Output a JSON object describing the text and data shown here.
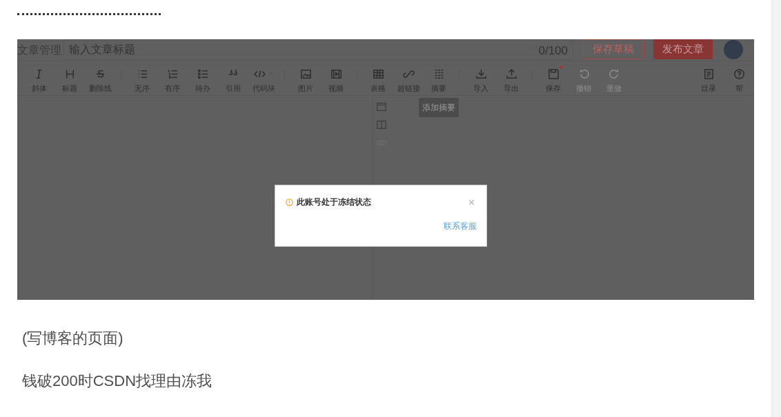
{
  "editor_screenshot": {
    "header": {
      "section": "文章管理",
      "title_field": {
        "placeholder": "输入文章标题"
      },
      "counter": "0/100",
      "buttons": [
        {
          "label": "保存草稿",
          "kind": "outline"
        },
        {
          "label": "发布文章",
          "kind": "primary"
        }
      ]
    },
    "toolbar": {
      "groups": [
        [
          {
            "label": "斜体",
            "disabled": false
          },
          {
            "label": "标题",
            "disabled": false
          },
          {
            "label": "删除线",
            "disabled": false
          }
        ],
        [
          {
            "label": "无序",
            "disabled": false
          },
          {
            "label": "有序",
            "disabled": false
          },
          {
            "label": "待办",
            "disabled": false
          },
          {
            "label": "引用",
            "disabled": false
          },
          {
            "label": "代码块",
            "disabled": false,
            "dropdown": true
          }
        ],
        [
          {
            "label": "图片",
            "disabled": false
          },
          {
            "label": "视频",
            "disabled": false
          }
        ],
        [
          {
            "label": "表格",
            "disabled": false
          },
          {
            "label": "超链接",
            "disabled": false
          },
          {
            "label": "摘要",
            "disabled": false,
            "tooltip": "添加摘要"
          }
        ],
        [
          {
            "label": "导入",
            "disabled": false
          },
          {
            "label": "导出",
            "disabled": false
          }
        ],
        [
          {
            "label": "保存",
            "disabled": false,
            "unsaved_dot": true
          },
          {
            "label": "撤销",
            "disabled": true
          },
          {
            "label": "重做",
            "disabled": true
          }
        ],
        [
          {
            "label": "目录",
            "disabled": false
          },
          {
            "label": "帮",
            "disabled": false
          }
        ]
      ]
    },
    "side_buttons": [
      {
        "disabled": false
      },
      {
        "disabled": false
      },
      {
        "disabled": true
      }
    ],
    "dialog": {
      "title": "此账号处于冻结状态",
      "link": "联系客服"
    }
  },
  "paragraphs": [
    "(写博客的页面)",
    "钱破200时CSDN找理由冻我"
  ]
}
